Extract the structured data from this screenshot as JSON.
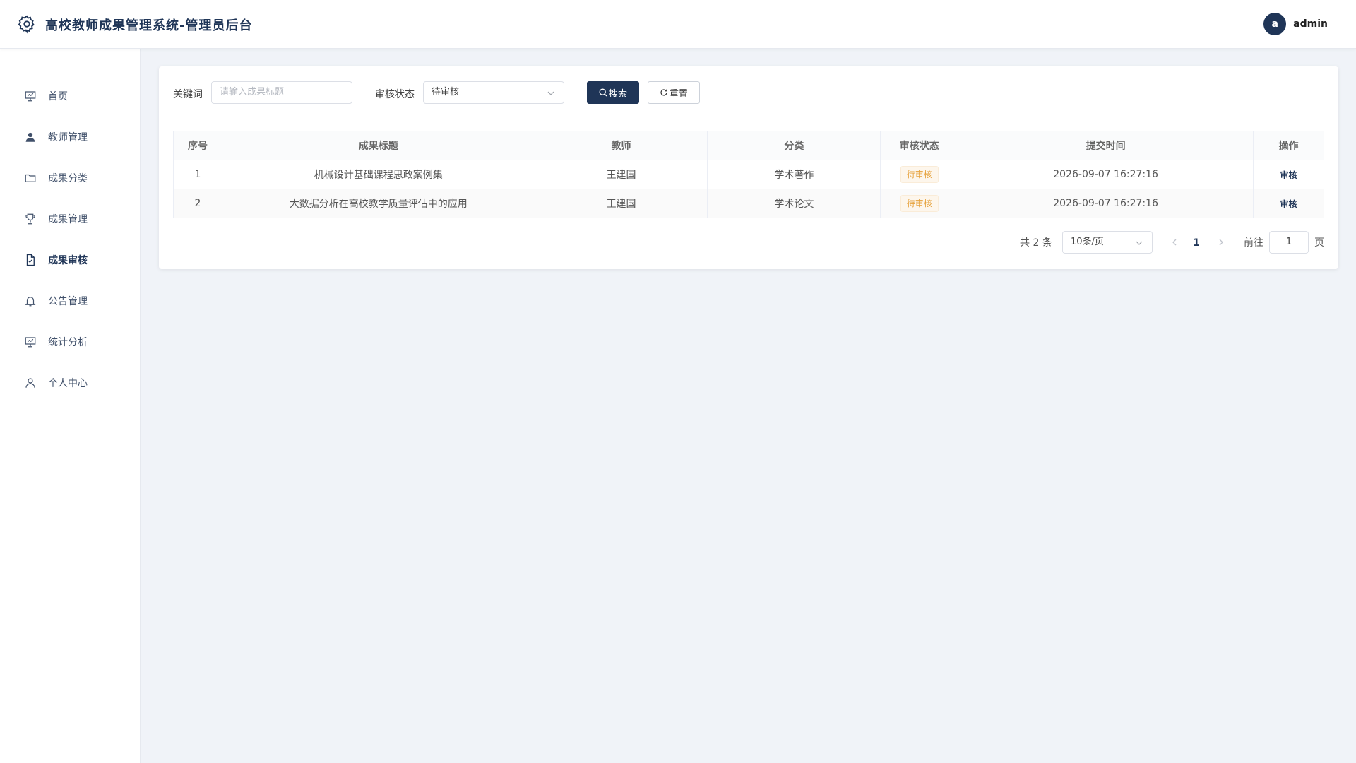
{
  "header": {
    "title": "高校教师成果管理系统-管理员后台",
    "avatar_letter": "a",
    "username": "admin",
    "logo_icon": "gear-icon"
  },
  "sidebar": {
    "items": [
      {
        "label": "首页",
        "icon": "presentation-icon",
        "active": false
      },
      {
        "label": "教师管理",
        "icon": "user-icon",
        "active": false
      },
      {
        "label": "成果分类",
        "icon": "folder-icon",
        "active": false
      },
      {
        "label": "成果管理",
        "icon": "trophy-icon",
        "active": false
      },
      {
        "label": "成果审核",
        "icon": "document-check-icon",
        "active": true
      },
      {
        "label": "公告管理",
        "icon": "bell-icon",
        "active": false
      },
      {
        "label": "统计分析",
        "icon": "presentation-icon",
        "active": false
      },
      {
        "label": "个人中心",
        "icon": "user-outline-icon",
        "active": false
      }
    ]
  },
  "filters": {
    "keyword_label": "关键词",
    "keyword_placeholder": "请输入成果标题",
    "status_label": "审核状态",
    "status_value": "待审核",
    "search_label": "搜索",
    "reset_label": "重置"
  },
  "table": {
    "columns": [
      "序号",
      "成果标题",
      "教师",
      "分类",
      "审核状态",
      "提交时间",
      "操作"
    ],
    "rows": [
      {
        "index": "1",
        "title": "机械设计基础课程思政案例集",
        "teacher": "王建国",
        "category": "学术著作",
        "status": "待审核",
        "time": "2026-09-07 16:27:16",
        "action": "审核"
      },
      {
        "index": "2",
        "title": "大数据分析在高校教学质量评估中的应用",
        "teacher": "王建国",
        "category": "学术论文",
        "status": "待审核",
        "time": "2026-09-07 16:27:16",
        "action": "审核"
      }
    ]
  },
  "pagination": {
    "total_text": "共 2 条",
    "page_size": "10条/页",
    "current_page": "1",
    "goto_label": "前往",
    "goto_value": "1",
    "page_unit": "页"
  },
  "colors": {
    "primary": "#1f3557",
    "background": "#f0f3f8",
    "status_pending": "#e6a23c"
  }
}
